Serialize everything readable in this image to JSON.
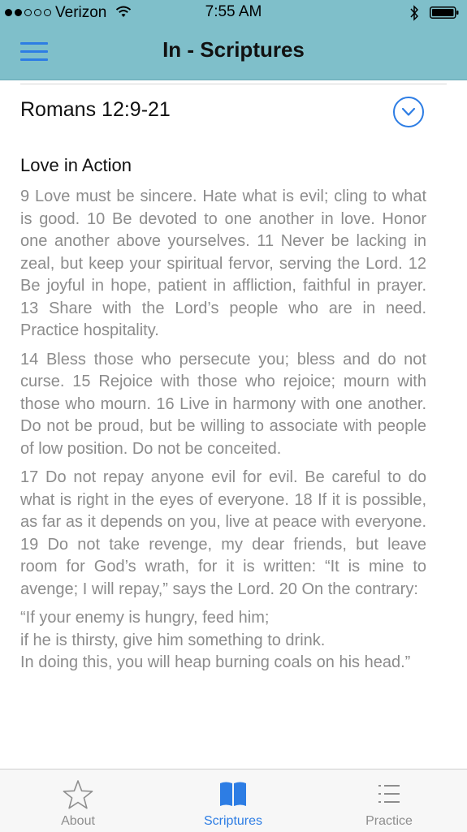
{
  "status_bar": {
    "carrier": "Verizon",
    "time": "7:55 AM",
    "signal_bars": 2,
    "signal_total": 5
  },
  "nav": {
    "title": "In - Scriptures",
    "menu_icon": "hamburger-menu-icon"
  },
  "passage": {
    "reference": "Romans 12:9-21",
    "expand_icon": "chevron-down-circle-icon",
    "section_title": "Love in Action",
    "paragraphs": [
      "9 Love must be sincere. Hate what is evil; cling to what is good. 10 Be devoted to one another in love. Honor one another above yourselves. 11 Never be lacking in zeal, but keep your spiritual fervor, serving the Lord. 12 Be joyful in hope, patient in affliction, faithful in prayer. 13 Share with the Lord’s people who are in need. Practice hospitality.",
      "14 Bless those who persecute you; bless and do not curse. 15 Rejoice with those who rejoice; mourn with those who mourn. 16 Live in harmony with one another. Do not be proud, but be willing to associate with people of low position. Do not be conceited.",
      "17 Do not repay anyone evil for evil. Be careful to do what is right in the eyes of everyone. 18 If it is possible, as far as it depends on you, live at peace with everyone. 19 Do not take revenge, my dear friends, but leave room for God’s wrath, for it is written: “It is mine to avenge; I will repay,” says the Lord. 20 On the contrary:"
    ],
    "quote_lines": [
      "“If your enemy is hungry, feed him;",
      "if he is thirsty, give him something to drink.",
      "In doing this, you will heap burning coals on his head.”"
    ]
  },
  "tabs": [
    {
      "label": "About",
      "icon": "star-icon",
      "active": false
    },
    {
      "label": "Scriptures",
      "icon": "book-icon",
      "active": true
    },
    {
      "label": "Practice",
      "icon": "list-icon",
      "active": false
    }
  ],
  "colors": {
    "header_bg": "#7fbfca",
    "accent": "#2d7de4",
    "body_text": "#8c8c8c",
    "tab_inactive": "#8e8e8e"
  }
}
